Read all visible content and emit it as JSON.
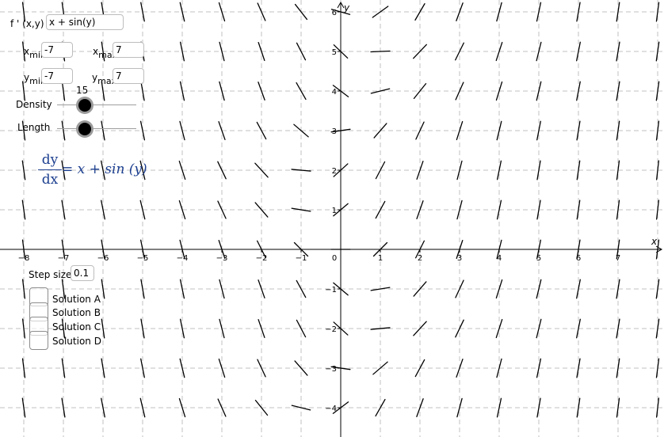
{
  "graph": {
    "axes": {
      "x_label": "x",
      "y_label": "y"
    },
    "x_ticks": [
      "−8",
      "−7",
      "−6",
      "−5",
      "−4",
      "−3",
      "−2",
      "−1",
      "0",
      "1",
      "2",
      "3",
      "4",
      "5",
      "6",
      "7"
    ],
    "y_ticks_pos": [
      "6",
      "5",
      "4",
      "3",
      "2",
      "1"
    ],
    "y_ticks_neg": [
      "−1",
      "−2",
      "−3",
      "−4"
    ],
    "grid_color": "#c0c0c0",
    "segment_color": "#000000"
  },
  "function": {
    "label": "f ' (x,y) =",
    "value": "x + sin(y)"
  },
  "range": {
    "xmin": {
      "label": "x",
      "sub": "min",
      "value": "-7"
    },
    "xmax": {
      "label": "x",
      "sub": "max",
      "value": "7"
    },
    "ymin": {
      "label": "y",
      "sub": "min",
      "value": "-7"
    },
    "ymax": {
      "label": "y",
      "sub": "max",
      "value": "7"
    }
  },
  "sliders": {
    "density": {
      "label": "Density",
      "value": "15",
      "level": 0.4
    },
    "length": {
      "label": "Length",
      "level": 0.4
    }
  },
  "formula": {
    "num": "dy",
    "den": "dx",
    "rhs": "= x + sin (y)",
    "color": "#1c3f8f"
  },
  "step": {
    "label": "Step size:",
    "value": "0.1"
  },
  "solutions": [
    {
      "label": "Solution A"
    },
    {
      "label": "Solution B"
    },
    {
      "label": "Solution C"
    },
    {
      "label": "Solution D"
    }
  ]
}
